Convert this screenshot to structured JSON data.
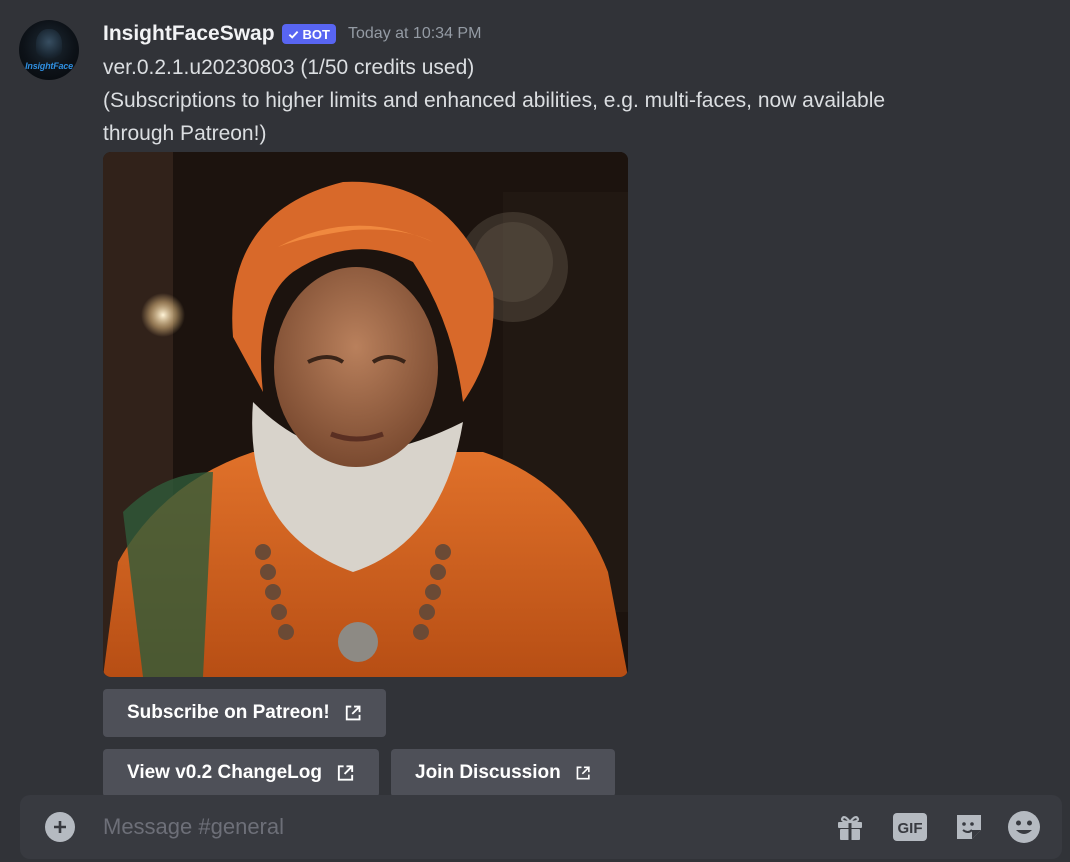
{
  "message": {
    "author": "InsightFaceSwap",
    "badge": "BOT",
    "timestamp": "Today at 10:34 PM",
    "avatar_text": "InsightFace",
    "lines": [
      "ver.0.2.1.u20230803 (1/50 credits used)",
      "(Subscriptions to higher limits and enhanced abilities, e.g. multi-faces, now available",
      "through Patreon!)"
    ],
    "image_icon": "portrait-image",
    "buttons": [
      {
        "label": "Subscribe on Patreon!",
        "icon": "external-link-icon"
      },
      {
        "label": "View v0.2 ChangeLog",
        "icon": "external-link-icon"
      },
      {
        "label": "Join Discussion",
        "icon": "external-link-icon"
      }
    ]
  },
  "composer": {
    "placeholder": "Message #general",
    "icons": [
      "plus-icon",
      "gift-icon",
      "gif-icon",
      "sticker-icon",
      "emoji-icon"
    ],
    "gif_label": "GIF"
  },
  "colors": {
    "background": "#313338",
    "composer": "#383a40",
    "button": "#4e5058",
    "bot_badge": "#5865f2",
    "timestamp": "#949ba4",
    "text": "#dbdee1"
  }
}
